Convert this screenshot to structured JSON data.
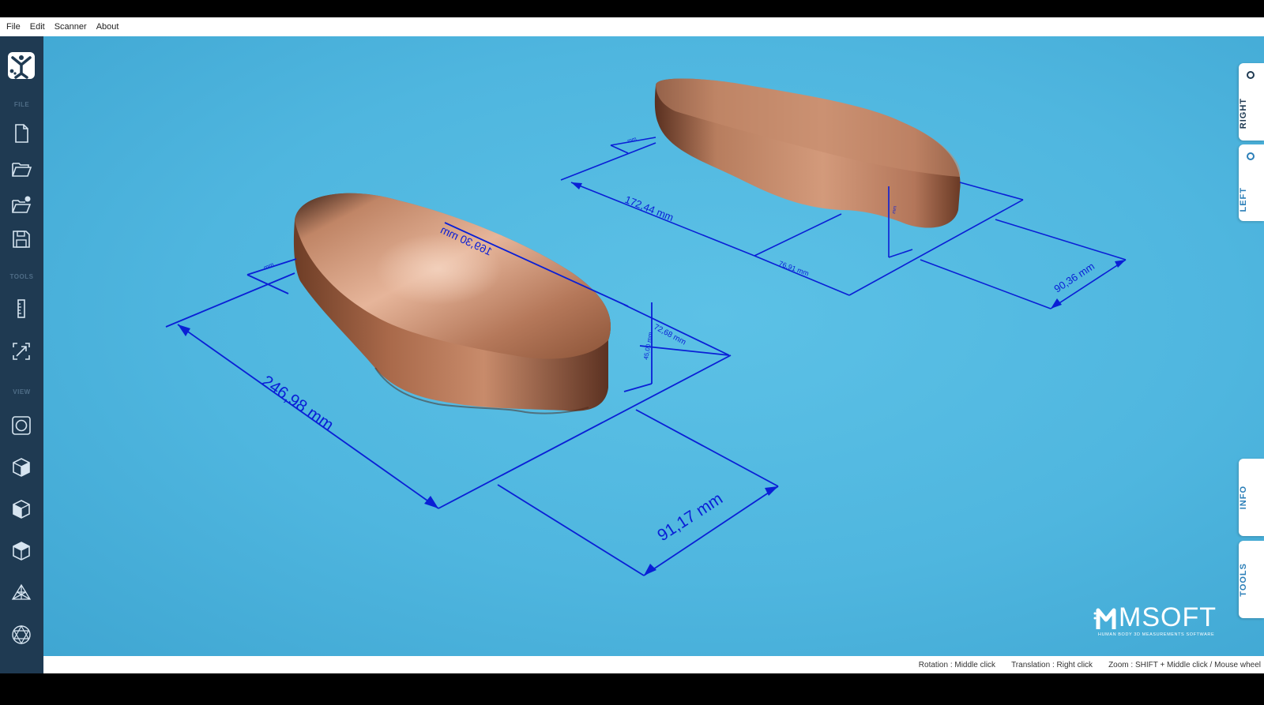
{
  "menu": [
    "File",
    "Edit",
    "Scanner",
    "About"
  ],
  "sidebar": {
    "sections": {
      "file": "FILE",
      "tools": "TOOLS",
      "view": "VIEW"
    },
    "file_buttons": [
      "new-file-icon",
      "open-folder-icon",
      "import-folder-icon",
      "save-icon"
    ],
    "tool_buttons": [
      "ruler-icon",
      "resize-icon"
    ],
    "view_buttons": [
      "frame-view-icon",
      "cube-front-icon",
      "cube-side-icon",
      "cube-top-icon",
      "mesh-grid-icon",
      "wireframe-icon"
    ]
  },
  "right_tabs": {
    "right": "RIGHT",
    "left": "LEFT",
    "info": "INFO",
    "tools": "TOOLS"
  },
  "measurements": {
    "left_foot": {
      "length": "246,98 mm",
      "width": "91,17 mm",
      "ball_length": "169,30 mm",
      "ball_width": "72,68 mm",
      "height": "45,00 mm",
      "heel": "mm"
    },
    "right_foot": {
      "length": "172,44 mm",
      "width": "90,36 mm",
      "ball_width": "76,91 mm",
      "heel": "mm",
      "height": "mm"
    }
  },
  "status": {
    "rotation": "Rotation : Middle click",
    "translation": "Translation : Right click",
    "zoom": "Zoom : SHIFT + Middle click / Mouse wheel"
  },
  "brand": {
    "name": "MSOFT",
    "tagline": "HUMAN BODY 3D MEASUREMENTS SOFTWARE"
  },
  "colors": {
    "viewport": "#4fb6df",
    "sidebar": "#1f3a52",
    "dimension_lines": "#0a1fd6",
    "foot": "#b5785a"
  }
}
